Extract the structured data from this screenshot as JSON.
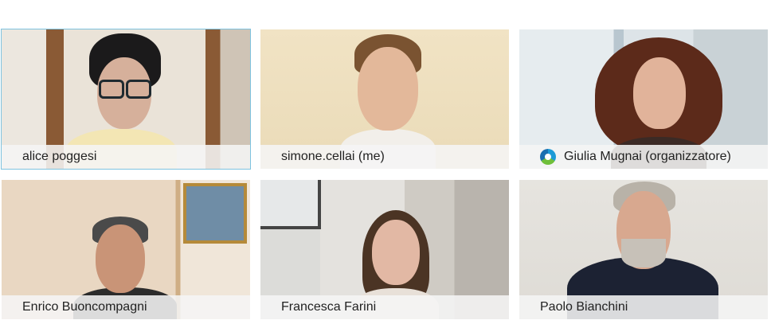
{
  "participants": [
    {
      "name": "alice poggesi",
      "active_speaker": true,
      "colors": {
        "wall": "#e9e4dc",
        "frame": "#8a5a35",
        "skin": "#d6b09b",
        "hair": "#1b1a1b",
        "shirt": "#f3e6b4"
      }
    },
    {
      "name": "simone.cellai (me)",
      "active_speaker": false,
      "colors": {
        "wall": "#efe0bf",
        "skin": "#e3b89a",
        "hair": "#7a5331",
        "shirt": "#f2efea"
      }
    },
    {
      "name": "Giulia Mugnai (organizzatore)",
      "organizer_icon": "webex-logo-icon",
      "active_speaker": false,
      "colors": {
        "wall": "#dce3e6",
        "skin": "#e1b39a",
        "hair": "#5c2a1a",
        "shirt": "#3b2a25"
      }
    },
    {
      "name": "Enrico Buoncompagni",
      "active_speaker": false,
      "colors": {
        "wall": "#e8d4bd",
        "skin": "#c99477",
        "hair": "#4a4a4a",
        "shirt": "#2c2c2c"
      }
    },
    {
      "name": "Francesca Farini",
      "active_speaker": false,
      "colors": {
        "wall": "#d6d5d2",
        "skin": "#e2b8a4",
        "hair": "#4b3424",
        "shirt": "#e8e0d8"
      }
    },
    {
      "name": "Paolo Bianchini",
      "active_speaker": false,
      "colors": {
        "wall": "#e3e1dc",
        "skin": "#d8a88f",
        "hair": "#b8b2a8",
        "shirt": "#1c2233"
      }
    }
  ]
}
